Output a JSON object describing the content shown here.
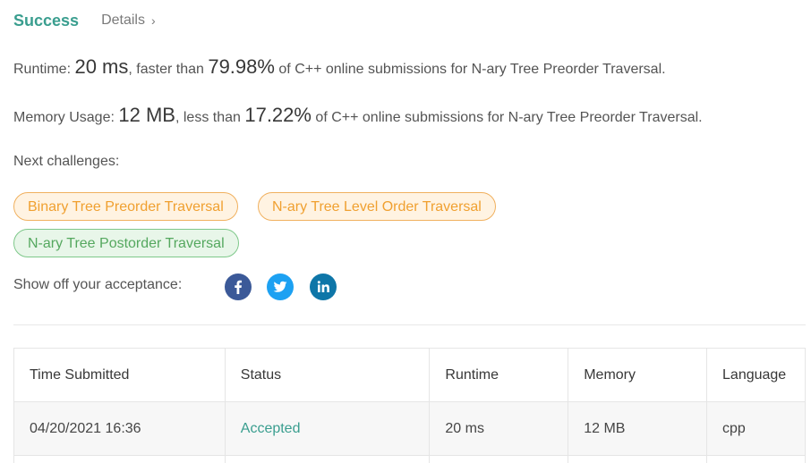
{
  "header": {
    "status": "Success",
    "details_label": "Details",
    "chevron": "›"
  },
  "runtime": {
    "label": "Runtime: ",
    "value": "20 ms",
    "middle": ", faster than ",
    "percent": "79.98%",
    "suffix": " of C++ online submissions for N-ary Tree Preorder Traversal."
  },
  "memory": {
    "label": "Memory Usage: ",
    "value": "12 MB",
    "middle": ", less than ",
    "percent": "17.22%",
    "suffix": " of C++ online submissions for N-ary Tree Preorder Traversal."
  },
  "next_challenges": {
    "label": "Next challenges:",
    "items": [
      {
        "label": "Binary Tree Preorder Traversal",
        "difficulty": "medium"
      },
      {
        "label": "N-ary Tree Level Order Traversal",
        "difficulty": "medium"
      },
      {
        "label": "N-ary Tree Postorder Traversal",
        "difficulty": "easy"
      }
    ]
  },
  "share": {
    "label": "Show off your acceptance:",
    "icons": [
      "facebook-icon",
      "twitter-icon",
      "linkedin-icon"
    ]
  },
  "colors": {
    "accent": "#3a9e8f",
    "medium_text": "#f0a030",
    "medium_bg": "#fff3e2",
    "easy_text": "#55a85f",
    "easy_bg": "#e8f6e9",
    "facebook": "#3b5998",
    "twitter": "#1da1f2",
    "linkedin": "#0e76a8"
  },
  "table": {
    "headers": [
      "Time Submitted",
      "Status",
      "Runtime",
      "Memory",
      "Language"
    ],
    "rows": [
      {
        "time": "04/20/2021 16:36",
        "status": "Accepted",
        "runtime": "20 ms",
        "memory": "12 MB",
        "language": "cpp"
      }
    ]
  }
}
